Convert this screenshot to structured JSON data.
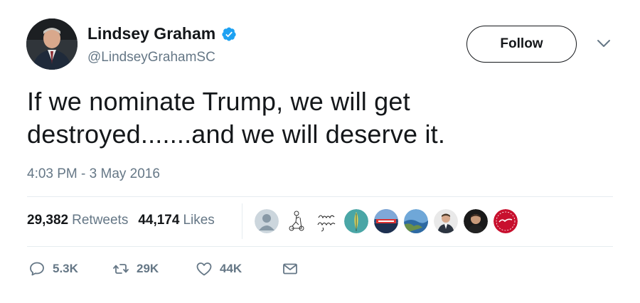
{
  "author": {
    "name": "Lindsey Graham",
    "handle": "@LindseyGrahamSC",
    "verified_color": "#1da1f2"
  },
  "follow": {
    "label": "Follow"
  },
  "tweet": {
    "line1": "If we nominate Trump, we will get",
    "line2": "destroyed.......and we will deserve it.",
    "timestamp": "4:03 PM - 3 May 2016"
  },
  "stats": {
    "retweets_count": "29,382",
    "retweets_label": "Retweets",
    "likes_count": "44,174",
    "likes_label": "Likes"
  },
  "likers": [
    {
      "icon": "default-avatar"
    },
    {
      "icon": "scooter-sketch"
    },
    {
      "icon": "keep-going-script"
    },
    {
      "icon": "teal-feather"
    },
    {
      "icon": "stadium-photo"
    },
    {
      "icon": "coastline-photo"
    },
    {
      "icon": "man-in-suit"
    },
    {
      "icon": "man-dark-portrait"
    },
    {
      "icon": "red-badge"
    }
  ],
  "actions": {
    "reply_count": "5.3K",
    "retweet_count": "29K",
    "like_count": "44K"
  },
  "colors": {
    "text": "#14171a",
    "muted": "#657786",
    "divider": "#e6ecf0"
  }
}
